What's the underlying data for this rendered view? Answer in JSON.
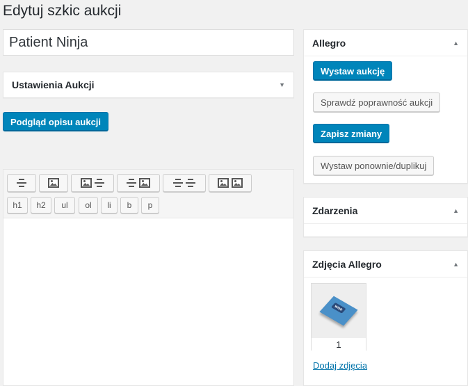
{
  "page": {
    "title": "Edytuj szkic aukcji"
  },
  "post": {
    "title_value": "Patient Ninja"
  },
  "settings_box": {
    "title": "Ustawienia Aukcji",
    "toggle_icon": "▼"
  },
  "preview_button": {
    "label": "Podgląd opisu aukcji"
  },
  "editor": {
    "layout_buttons": [
      {
        "name": "align-center-text",
        "icons": [
          "center"
        ]
      },
      {
        "name": "image-only",
        "icons": [
          "image"
        ]
      },
      {
        "name": "image-left-text",
        "icons": [
          "image",
          "center"
        ]
      },
      {
        "name": "text-image-right",
        "icons": [
          "center",
          "image"
        ]
      },
      {
        "name": "two-text-columns",
        "icons": [
          "center",
          "center"
        ]
      },
      {
        "name": "two-images",
        "icons": [
          "image",
          "image"
        ]
      }
    ],
    "tag_buttons": [
      "h1",
      "h2",
      "ul",
      "ol",
      "li",
      "b",
      "p"
    ]
  },
  "allegro_box": {
    "title": "Allegro",
    "toggle_icon": "▲",
    "buttons": {
      "post_auction": "Wystaw aukcję",
      "validate_auction": "Sprawdź poprawność aukcji",
      "save_changes": "Zapisz zmiany",
      "repost_duplicate": "Wystaw ponownie/duplikuj"
    }
  },
  "events_box": {
    "title": "Zdarzenia",
    "toggle_icon": "▲"
  },
  "photos_box": {
    "title": "Zdjęcia Allegro",
    "toggle_icon": "▲",
    "photos": [
      {
        "number": "1",
        "badge": "woo"
      }
    ],
    "add_link": "Dodaj zdjęcia"
  },
  "colors": {
    "primary": "#0085ba",
    "link": "#0073aa",
    "background": "#f1f1f1"
  }
}
